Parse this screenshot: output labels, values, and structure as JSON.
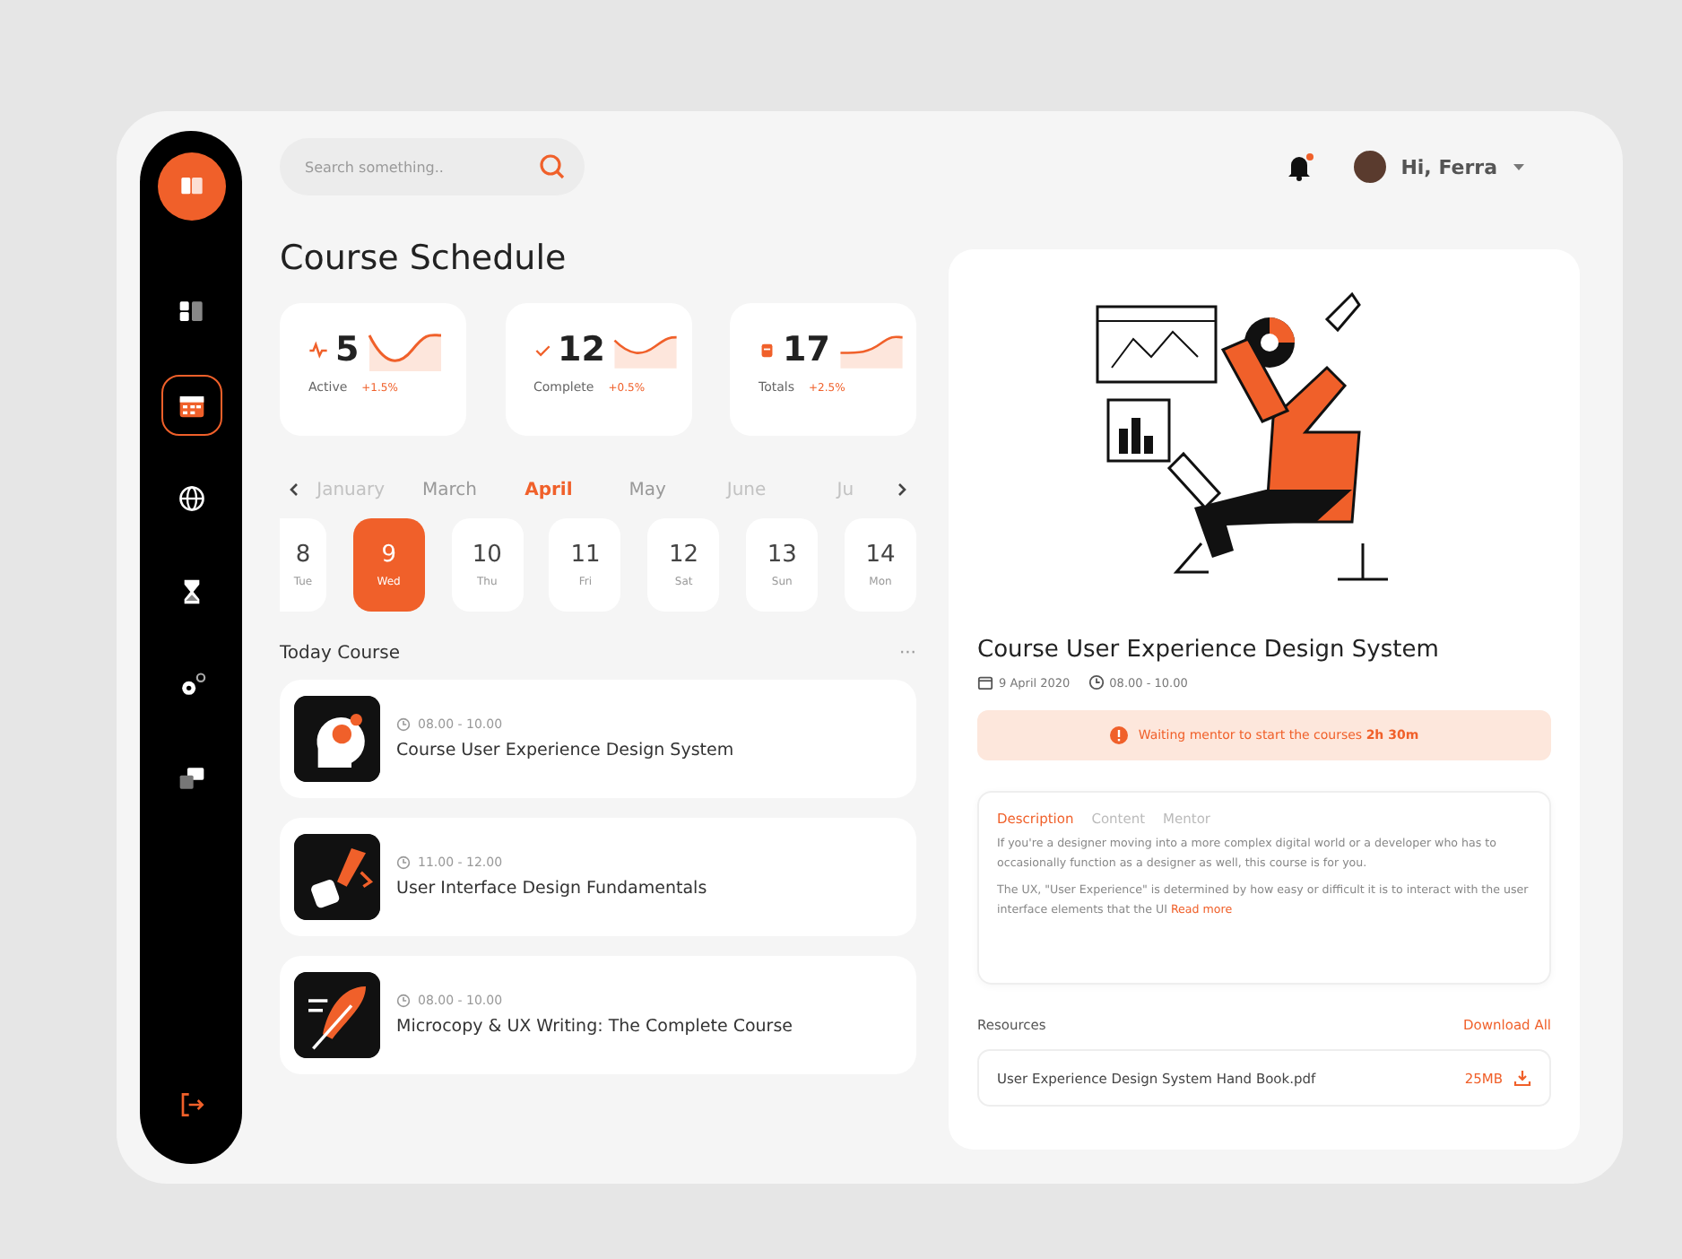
{
  "sidebar": {
    "items": [
      {
        "kind": "logo",
        "selected": false
      },
      {
        "kind": "dashboard",
        "selected": false
      },
      {
        "kind": "calendar",
        "selected": true
      },
      {
        "kind": "globe",
        "selected": false
      },
      {
        "kind": "hourglass",
        "selected": false
      },
      {
        "kind": "gears",
        "selected": false
      },
      {
        "kind": "chat",
        "selected": false
      }
    ],
    "logout": {
      "kind": "logout"
    }
  },
  "header": {
    "search": {
      "placeholder": "Search something.."
    },
    "notifications": {
      "unread": true
    },
    "user": {
      "greeting": "Hi, Ferra"
    }
  },
  "title": "Course Schedule",
  "stats": [
    {
      "kind": "pulse",
      "value": "5",
      "label": "Active",
      "change": "+1.5%"
    },
    {
      "kind": "check",
      "value": "12",
      "label": "Complete",
      "change": "+0.5%"
    },
    {
      "kind": "clipboard",
      "value": "17",
      "label": "Totals",
      "change": "+2.5%"
    }
  ],
  "months": [
    {
      "label": "January",
      "selected": false,
      "dimmed": true
    },
    {
      "label": "March",
      "selected": false,
      "dimmed": false
    },
    {
      "label": "April",
      "selected": true,
      "dimmed": false
    },
    {
      "label": "May",
      "selected": false,
      "dimmed": false
    },
    {
      "label": "June",
      "selected": false,
      "dimmed": true
    },
    {
      "label": "Ju",
      "selected": false,
      "dimmed": true
    }
  ],
  "days": [
    {
      "date": "8",
      "weekday": "Tue",
      "selected": false
    },
    {
      "date": "9",
      "weekday": "Wed",
      "selected": true
    },
    {
      "date": "10",
      "weekday": "Thu",
      "selected": false
    },
    {
      "date": "11",
      "weekday": "Fri",
      "selected": false
    },
    {
      "date": "12",
      "weekday": "Sat",
      "selected": false
    },
    {
      "date": "13",
      "weekday": "Sun",
      "selected": false
    },
    {
      "date": "14",
      "weekday": "Mon",
      "selected": false
    }
  ],
  "today": {
    "title": "Today Course",
    "more": "···",
    "courses": [
      {
        "kind": "head",
        "time": "08.00 - 10.00",
        "title": "Course User Experience Design System"
      },
      {
        "kind": "pen",
        "time": "11.00 - 12.00",
        "title": "User Interface Design Fundamentals"
      },
      {
        "kind": "feather",
        "time": "08.00 - 10.00",
        "title": "Microcopy & UX Writing: The Complete Course"
      }
    ]
  },
  "detail": {
    "title": "Course User Experience Design System",
    "date": "9 April 2020",
    "time": "08.00 - 10.00",
    "alert": "Waiting mentor to start the courses **2h 30m**",
    "tabs": [
      {
        "label": "Description",
        "selected": true
      },
      {
        "label": "Content",
        "selected": false
      },
      {
        "label": "Mentor",
        "selected": false
      }
    ],
    "paragraphs": [
      "If you're a designer moving into a more complex digital world or a developer who has to occasionally function as a designer as well, this course is for you.",
      "The UX, \"User Experience\" is determined by how easy or difficult it is to interact with the user interface elements that the UI"
    ],
    "read_more": "Read more",
    "resources": {
      "title": "Resources",
      "download_all": "Download All",
      "files": [
        {
          "name": "User Experience Design System Hand Book.pdf",
          "size": "25MB"
        }
      ]
    }
  }
}
